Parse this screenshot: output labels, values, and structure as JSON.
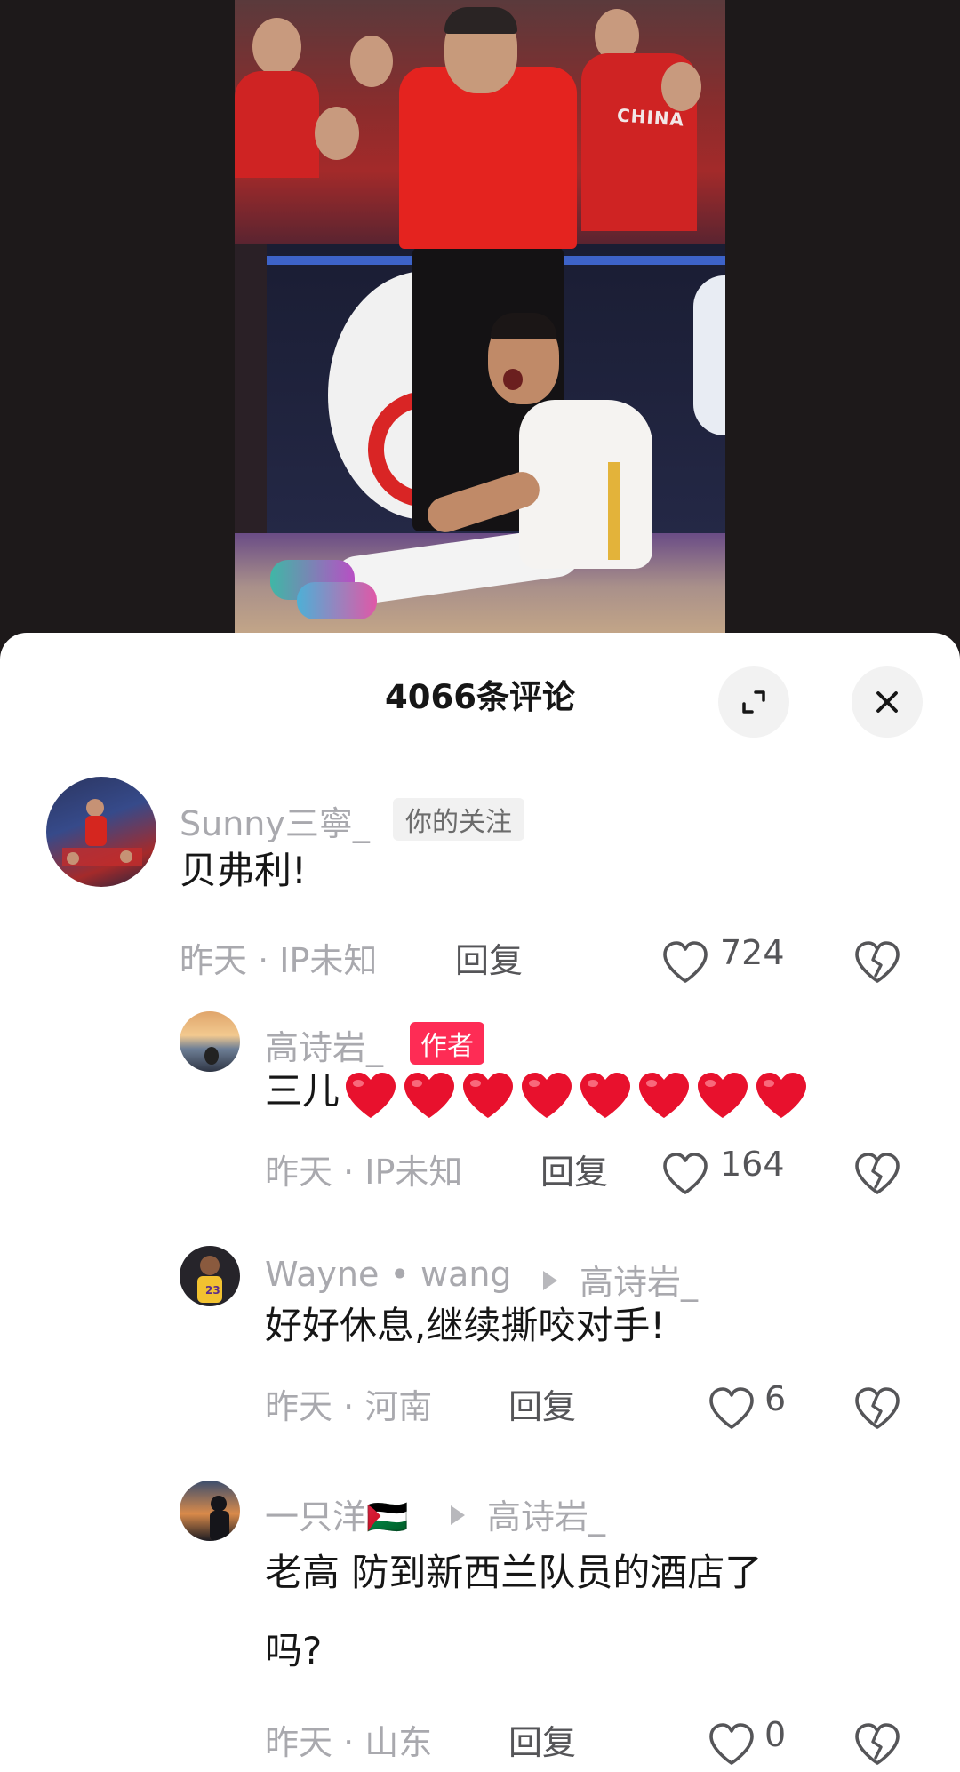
{
  "sheet": {
    "title": "4066条评论"
  },
  "comments": [
    {
      "username": "Sunny三寧_",
      "badge": "你的关注",
      "text": "贝弗利!",
      "time": "昨天 · IP未知",
      "reply": "回复",
      "likes": "724"
    },
    {
      "username": "高诗岩_",
      "badge": "作者",
      "text": "三儿",
      "heart_emoji_count": 8,
      "time": "昨天 · IP未知",
      "reply": "回复",
      "likes": "164"
    },
    {
      "username": "Wayne • wang",
      "reply_to": "高诗岩_",
      "text": "好好休息,继续撕咬对手!",
      "time": "昨天 · 河南",
      "reply": "回复",
      "likes": "6"
    },
    {
      "username": "一只洋🇵🇸",
      "reply_to": "高诗岩_",
      "text_line1": "老高 防到新西兰队员的酒店了",
      "text_line2": "吗?",
      "time": "昨天 · 山东",
      "reply": "回复",
      "likes": "0"
    }
  ],
  "icons": {
    "expand": "expand-icon",
    "close": "close-icon",
    "like": "heart-outline-icon",
    "dislike": "broken-heart-icon",
    "reply_arrow": "play-arrow-icon"
  },
  "colors": {
    "author_badge": "#fe2c55",
    "muted_text": "#a9a9ae",
    "heart_emoji": "#e8112d"
  },
  "photo_text": {
    "jersey": "CHINA"
  }
}
